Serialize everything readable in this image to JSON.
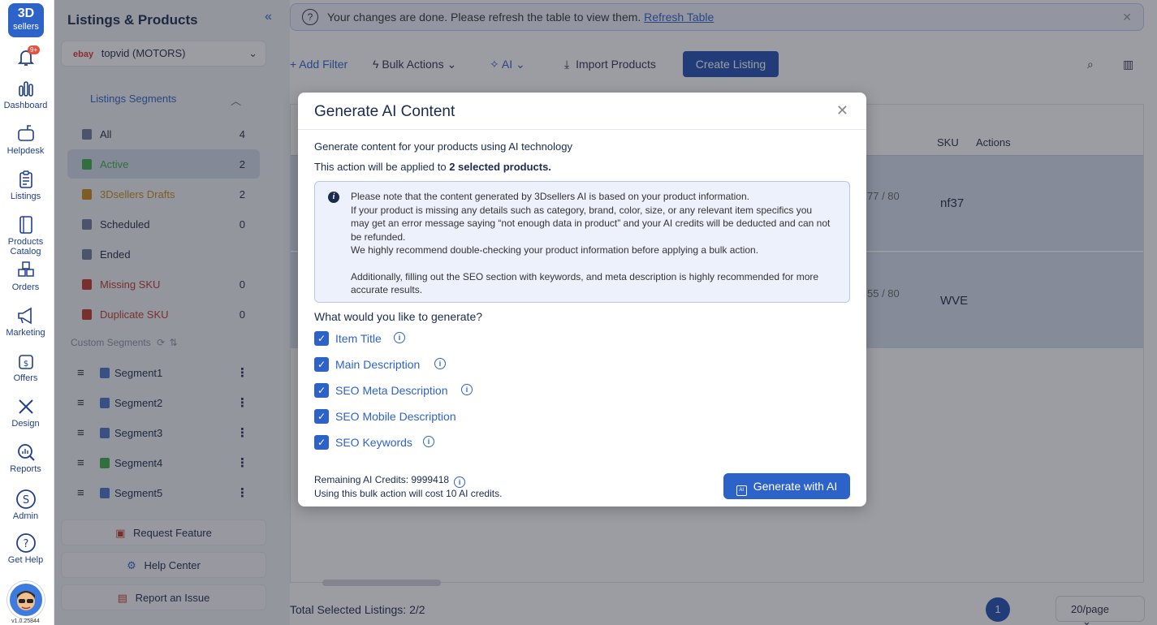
{
  "app": {
    "logo_line1": "3D",
    "logo_line2": "sellers",
    "notification_count": "9+",
    "version": "v1.0.25844"
  },
  "rail": {
    "items": [
      {
        "label": "Dashboard",
        "icon": "bar-chart-icon"
      },
      {
        "label": "Helpdesk",
        "icon": "mailbox-icon"
      },
      {
        "label": "Listings",
        "icon": "clipboard-icon"
      },
      {
        "label": "Products Catalog",
        "icon": "catalog-icon"
      },
      {
        "label": "Orders",
        "icon": "boxes-icon"
      },
      {
        "label": "Marketing",
        "icon": "megaphone-icon"
      },
      {
        "label": "Offers",
        "icon": "dollar-bag-icon"
      },
      {
        "label": "Design",
        "icon": "design-tools-icon"
      },
      {
        "label": "Reports",
        "icon": "magnifier-chart-icon"
      },
      {
        "label": "Admin",
        "icon": "s-circle-icon"
      },
      {
        "label": "Get Help",
        "icon": "question-circle-icon"
      }
    ]
  },
  "sidebar": {
    "title": "Listings & Products",
    "store": {
      "marketplace": "ebay",
      "name": "topvid (MOTORS)"
    },
    "segments_title": "Listings Segments",
    "segments": [
      {
        "label": "All",
        "count": "4",
        "color": "#1a2b4f"
      },
      {
        "label": "Active",
        "count": "2",
        "color": "#3cae4a"
      },
      {
        "label": "3Dsellers Drafts",
        "count": "2",
        "color": "#c98a1a"
      },
      {
        "label": "Scheduled",
        "count": "0",
        "color": "#1a2b4f"
      },
      {
        "label": "Ended",
        "count": "",
        "color": "#1a2b4f"
      },
      {
        "label": "Missing SKU",
        "count": "0",
        "color": "#c0392b"
      },
      {
        "label": "Duplicate SKU",
        "count": "0",
        "color": "#c0392b"
      }
    ],
    "custom_segments_title": "Custom Segments",
    "custom_segments": [
      "Segment1",
      "Segment2",
      "Segment3",
      "Segment4",
      "Segment5"
    ],
    "buttons": {
      "request_feature": "Request Feature",
      "help_center": "Help Center",
      "report_issue": "Report an Issue"
    }
  },
  "main": {
    "notice": {
      "text": "Your changes are done. Please refresh the table to view them.",
      "link": "Refresh Table"
    },
    "toolbar": {
      "add_filter": "+ Add Filter",
      "bulk_actions": "Bulk Actions",
      "ai": "AI",
      "import_products": "Import Products",
      "create_listing": "Create Listing"
    },
    "table": {
      "col_sku": "SKU",
      "col_actions": "Actions",
      "rows": [
        {
          "count": "77 / 80",
          "sku": "nf37"
        },
        {
          "count": "55 / 80",
          "sku": "WVE"
        }
      ]
    },
    "footer": {
      "selected": "Total Selected Listings: 2/2",
      "page": "1",
      "page_size": "20/page"
    }
  },
  "modal": {
    "title": "Generate AI Content",
    "description": "Generate content for your products using AI technology",
    "applied_prefix": "This action will be applied to ",
    "applied_count": "2 selected products.",
    "info_lines": [
      "Please note that the content generated by 3Dsellers AI is based on your product information.",
      "If your product is missing any details such as category, brand, color, size, or any relevant item specifics you may get an error message saying “not enough data in product” and your AI credits will be deducted and can not be refunded.",
      "We highly recommend double-checking your product information before applying a bulk action.",
      "Additionally, filling out the SEO section with keywords, and meta description is highly recommended for more accurate results."
    ],
    "question": "What would you like to generate?",
    "options": [
      {
        "label": "Item Title",
        "checked": true,
        "has_info": true
      },
      {
        "label": "Main Description",
        "checked": true,
        "has_info": true
      },
      {
        "label": "SEO Meta Description",
        "checked": true,
        "has_info": true
      },
      {
        "label": "SEO Mobile Description",
        "checked": true,
        "has_info": false
      },
      {
        "label": "SEO Keywords",
        "checked": true,
        "has_info": true
      }
    ],
    "credits_remaining": "Remaining AI Credits: 9999418",
    "credits_cost": "Using this bulk action will cost 10 AI credits.",
    "generate_button": "Generate with AI"
  }
}
